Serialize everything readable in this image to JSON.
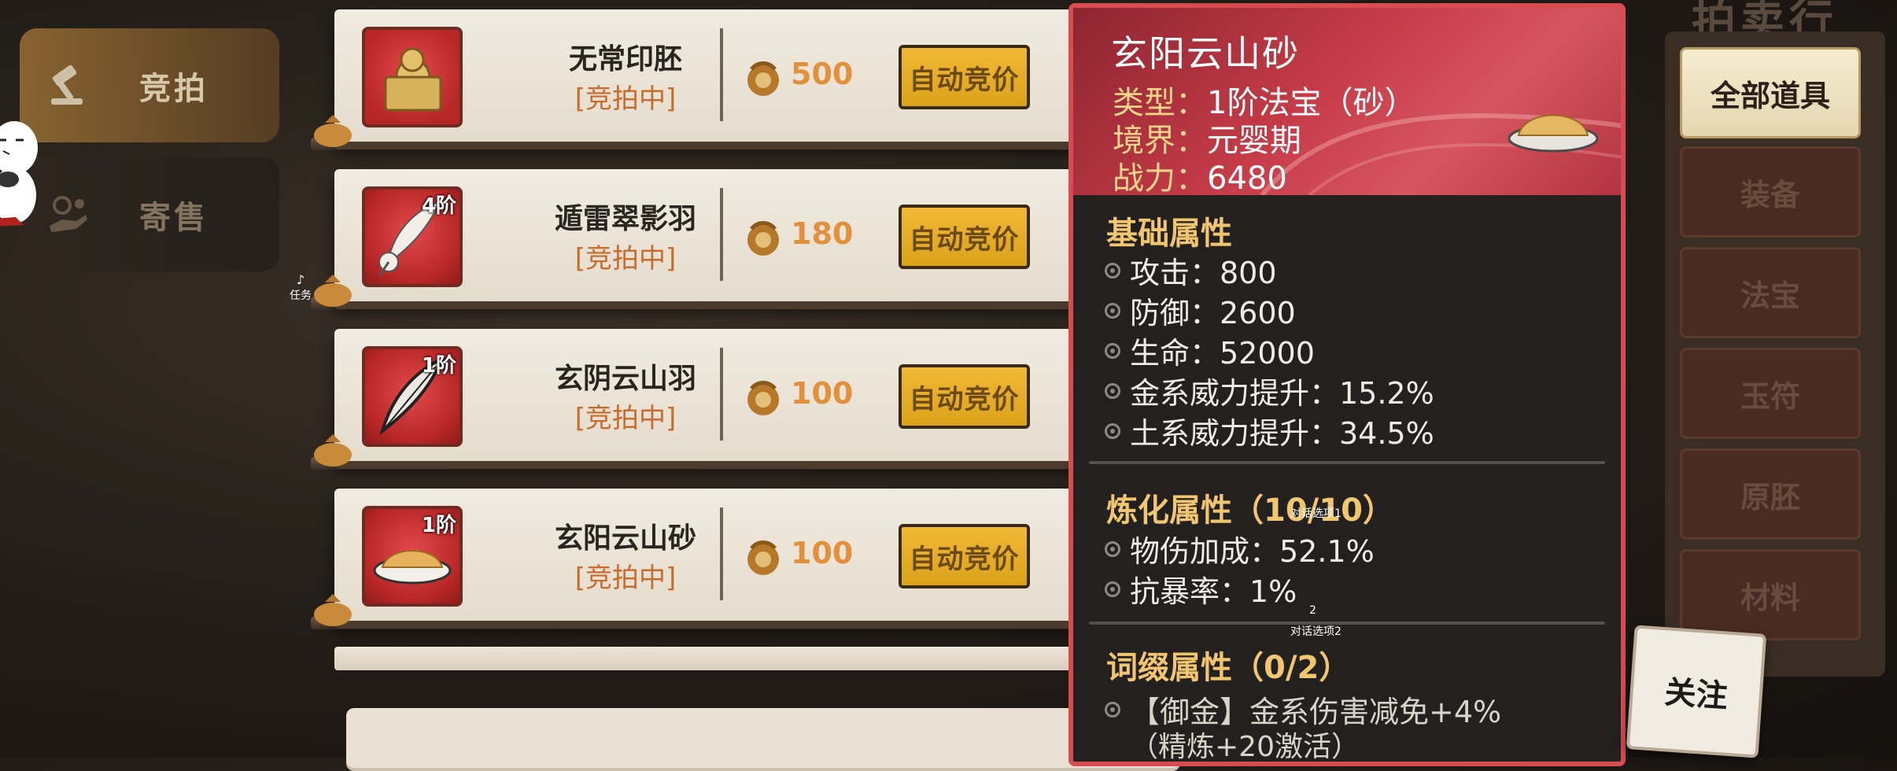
{
  "sidebar": {
    "auction_label": "竞拍",
    "consign_label": "寄售",
    "task_badge_num": "♪",
    "task_label": "任务"
  },
  "hall": {
    "title": "拍卖行"
  },
  "auction": {
    "bid_button_label": "自动竞价",
    "rows": [
      {
        "name": "无常印胚",
        "status": "[竞拍中]",
        "price": "500",
        "tier": "",
        "icon": "seal-icon"
      },
      {
        "name": "遁雷翠影羽",
        "status": "[竞拍中]",
        "price": "180",
        "tier": "4阶",
        "icon": "feather-icon"
      },
      {
        "name": "玄阴云山羽",
        "status": "[竞拍中]",
        "price": "100",
        "tier": "1阶",
        "icon": "feather-icon"
      },
      {
        "name": "玄阳云山砂",
        "status": "[竞拍中]",
        "price": "100",
        "tier": "1阶",
        "icon": "sand-plate-icon"
      }
    ]
  },
  "categories": {
    "items": [
      {
        "label": "全部道具",
        "active": true
      },
      {
        "label": "装备",
        "active": false
      },
      {
        "label": "法宝",
        "active": false
      },
      {
        "label": "玉符",
        "active": false
      },
      {
        "label": "原胚",
        "active": false
      },
      {
        "label": "材料",
        "active": false
      }
    ]
  },
  "follow_button": {
    "label": "关注"
  },
  "tooltip": {
    "title": "玄阳云山砂",
    "type_key": "类型：",
    "type_val": "1阶法宝（砂）",
    "realm_key": "境界：",
    "realm_val": "元婴期",
    "power_key": "战力：",
    "power_val": "6480",
    "base_title": "基础属性",
    "base_attrs": [
      "攻击：800",
      "防御：2600",
      "生命：52000",
      "金系威力提升：15.2%",
      "土系威力提升：34.5%"
    ],
    "refine_title": "炼化属性（10/10）",
    "refine_attrs": [
      "物伤加成：52.1%",
      "抗暴率：1%"
    ],
    "affix_title": "词缀属性（0/2）",
    "affix_attrs": [
      "【御金】金系伤害减免+4%"
    ],
    "affix_note": "（精炼+20激活）"
  },
  "overlays": {
    "dialog_option_1": "对话选项1",
    "option_2_num": "2",
    "dialog_option_2": "对话选项2"
  },
  "colors": {
    "tooltip_border": "#d84c50",
    "section_title": "#f1c66f",
    "status_text": "#c96b2b",
    "price_text": "#e2913a",
    "bid_button": "#f1b935"
  }
}
